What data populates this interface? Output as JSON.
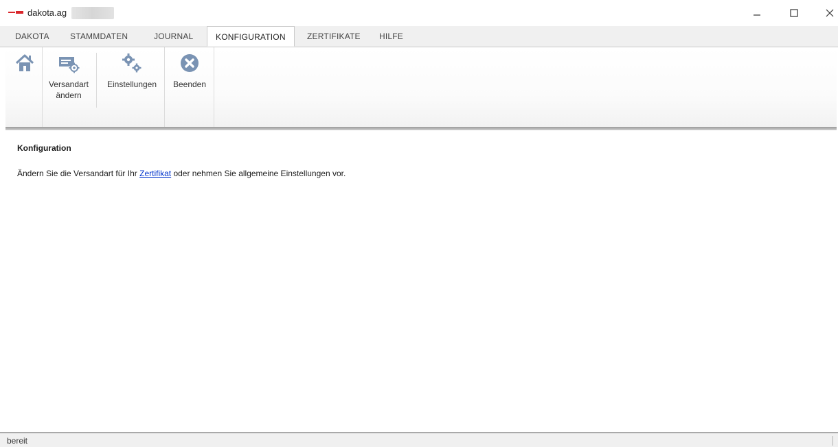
{
  "window": {
    "title": "dakota.ag"
  },
  "tabs": [
    {
      "label": "DAKOTA",
      "active": false
    },
    {
      "label": "STAMMDATEN",
      "active": false
    },
    {
      "label": "JOURNAL",
      "active": false
    },
    {
      "label": "KONFIGURATION",
      "active": true
    },
    {
      "label": "ZERTIFIKATE",
      "active": false
    },
    {
      "label": "HILFE",
      "active": false
    }
  ],
  "ribbon": {
    "home_icon": "home-icon",
    "buttons": [
      {
        "label": "Versandart\nändern",
        "icon": "shipping-settings-icon"
      },
      {
        "label": "Einstellungen",
        "icon": "gears-icon"
      },
      {
        "label": "Beenden",
        "icon": "close-circle-icon"
      }
    ]
  },
  "content": {
    "heading": "Konfiguration",
    "text_before": "Ändern Sie die Versandart für Ihr ",
    "link": "Zertifikat",
    "text_after": " oder nehmen Sie allgemeine Einstellungen vor."
  },
  "status": {
    "text": "bereit"
  },
  "colors": {
    "accent_red": "#d9262b",
    "icon_blue": "#7a93b3",
    "link_blue": "#0033cc"
  }
}
